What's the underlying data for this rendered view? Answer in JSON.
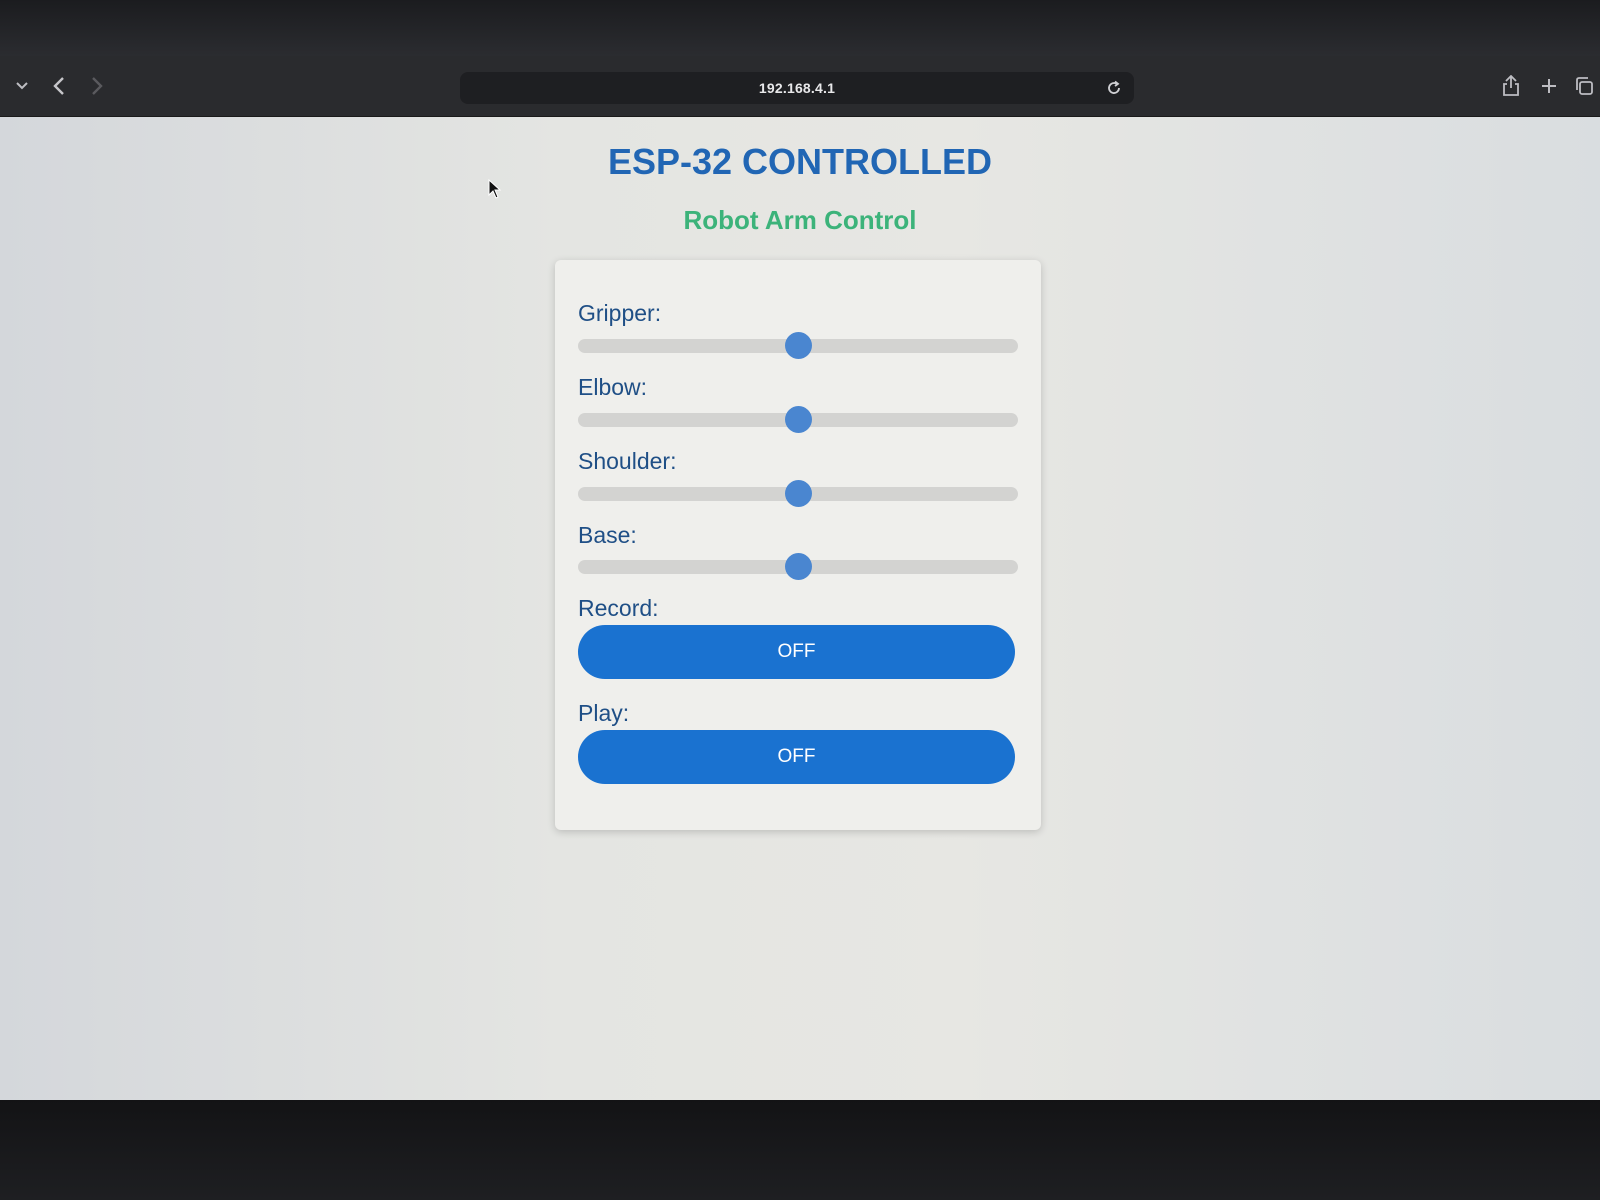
{
  "browser": {
    "address": "192.168.4.1",
    "icons": [
      "sidebar-chevron-icon",
      "back-icon",
      "forward-icon",
      "reload-icon",
      "share-icon",
      "new-tab-icon",
      "tabs-overview-icon"
    ]
  },
  "page": {
    "title": "ESP-32 CONTROLLED",
    "subtitle": "Robot Arm Control",
    "colors": {
      "title": "#2166b4",
      "subtitle": "#3cb37a",
      "button": "#1a72d0",
      "slider_thumb": "#4a86d0"
    }
  },
  "controls": {
    "sliders": [
      {
        "label": "Gripper:",
        "value": 0.5
      },
      {
        "label": "Elbow:",
        "value": 0.5
      },
      {
        "label": "Shoulder:",
        "value": 0.5
      },
      {
        "label": "Base:",
        "value": 0.5
      }
    ],
    "record": {
      "label": "Record:",
      "state": "OFF"
    },
    "play": {
      "label": "Play:",
      "state": "OFF"
    }
  }
}
